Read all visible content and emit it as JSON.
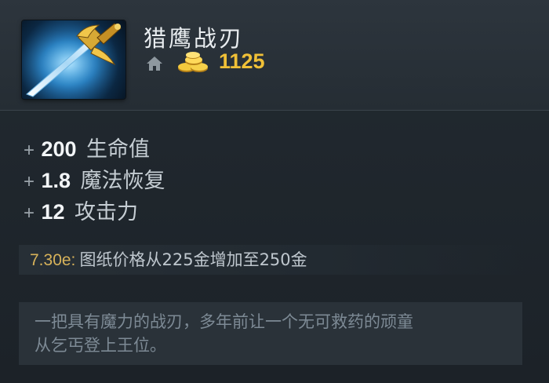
{
  "item": {
    "name": "猎鹰战刃",
    "icon": "falcon-blade-icon",
    "cost": "1125",
    "home_icon": "home-icon",
    "gold_icon": "gold-coins-icon"
  },
  "stats": [
    {
      "plus": "+",
      "value": "200",
      "label": "生命值"
    },
    {
      "plus": "+",
      "value": "1.8",
      "label": "魔法恢复"
    },
    {
      "plus": "+",
      "value": "12",
      "label": "攻击力"
    }
  ],
  "patch_note": {
    "version": "7.30e:",
    "text": "图纸价格从225金增加至250金"
  },
  "lore": {
    "line1": "一把具有魔力的战刃，多年前让一个无可救药的顽童",
    "line2": "从乞丐登上王位。"
  },
  "colors": {
    "gold": "#f0c037",
    "patch_version": "#d7b25a",
    "background": "#1c2228"
  }
}
